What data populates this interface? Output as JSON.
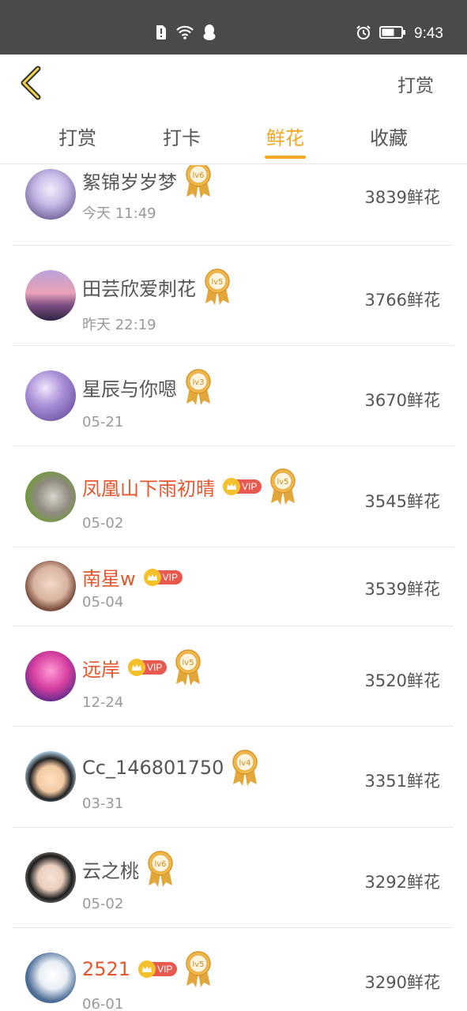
{
  "status_bar": {
    "time": "9:43"
  },
  "nav": {
    "action_label": "打赏"
  },
  "tabs": [
    {
      "label": "打赏",
      "active": false
    },
    {
      "label": "打卡",
      "active": false
    },
    {
      "label": "鲜花",
      "active": true
    },
    {
      "label": "收藏",
      "active": false
    }
  ],
  "colors": {
    "accent": "#f5a623",
    "vip_name": "#e8562f",
    "vip_tag": "#e85a4f",
    "medal_gold": "#e3a63a"
  },
  "ranking": [
    {
      "name": "絮锦岁岁梦",
      "vip": false,
      "level": "lv6",
      "time": "今天 11:49",
      "flowers": "3839鲜花",
      "avatar": "avatar-girl-anime-white-hair"
    },
    {
      "name": "田芸欣爱刺花",
      "vip": false,
      "level": "lv5",
      "time": "昨天 22:19",
      "flowers": "3766鲜花",
      "avatar": "avatar-sunset-sea"
    },
    {
      "name": "星辰与你嗯",
      "vip": false,
      "level": "lv3",
      "time": "05-21",
      "flowers": "3670鲜花",
      "avatar": "avatar-purple-sky"
    },
    {
      "name": "凤凰山下雨初晴",
      "vip": true,
      "vip_label": "VIP",
      "level": "lv5",
      "time": "05-02",
      "flowers": "3545鲜花",
      "avatar": "avatar-cat"
    },
    {
      "name": "南星w",
      "vip": true,
      "vip_label": "VIP",
      "level": "",
      "time": "05-04",
      "flowers": "3539鲜花",
      "avatar": "avatar-child"
    },
    {
      "name": "远岸",
      "vip": true,
      "vip_label": "VIP",
      "level": "lv5",
      "time": "12-24",
      "flowers": "3520鲜花",
      "avatar": "avatar-anime-pink"
    },
    {
      "name": "Cc_146801750",
      "vip": false,
      "level": "lv4",
      "time": "03-31",
      "flowers": "3351鲜花",
      "avatar": "avatar-cartoon-boy"
    },
    {
      "name": "云之桃",
      "vip": false,
      "level": "lv6",
      "time": "05-02",
      "flowers": "3292鲜花",
      "avatar": "avatar-young-man"
    },
    {
      "name": "2521",
      "vip": true,
      "vip_label": "VIP",
      "level": "lv5",
      "time": "06-01",
      "flowers": "3290鲜花",
      "avatar": "avatar-duck"
    }
  ]
}
